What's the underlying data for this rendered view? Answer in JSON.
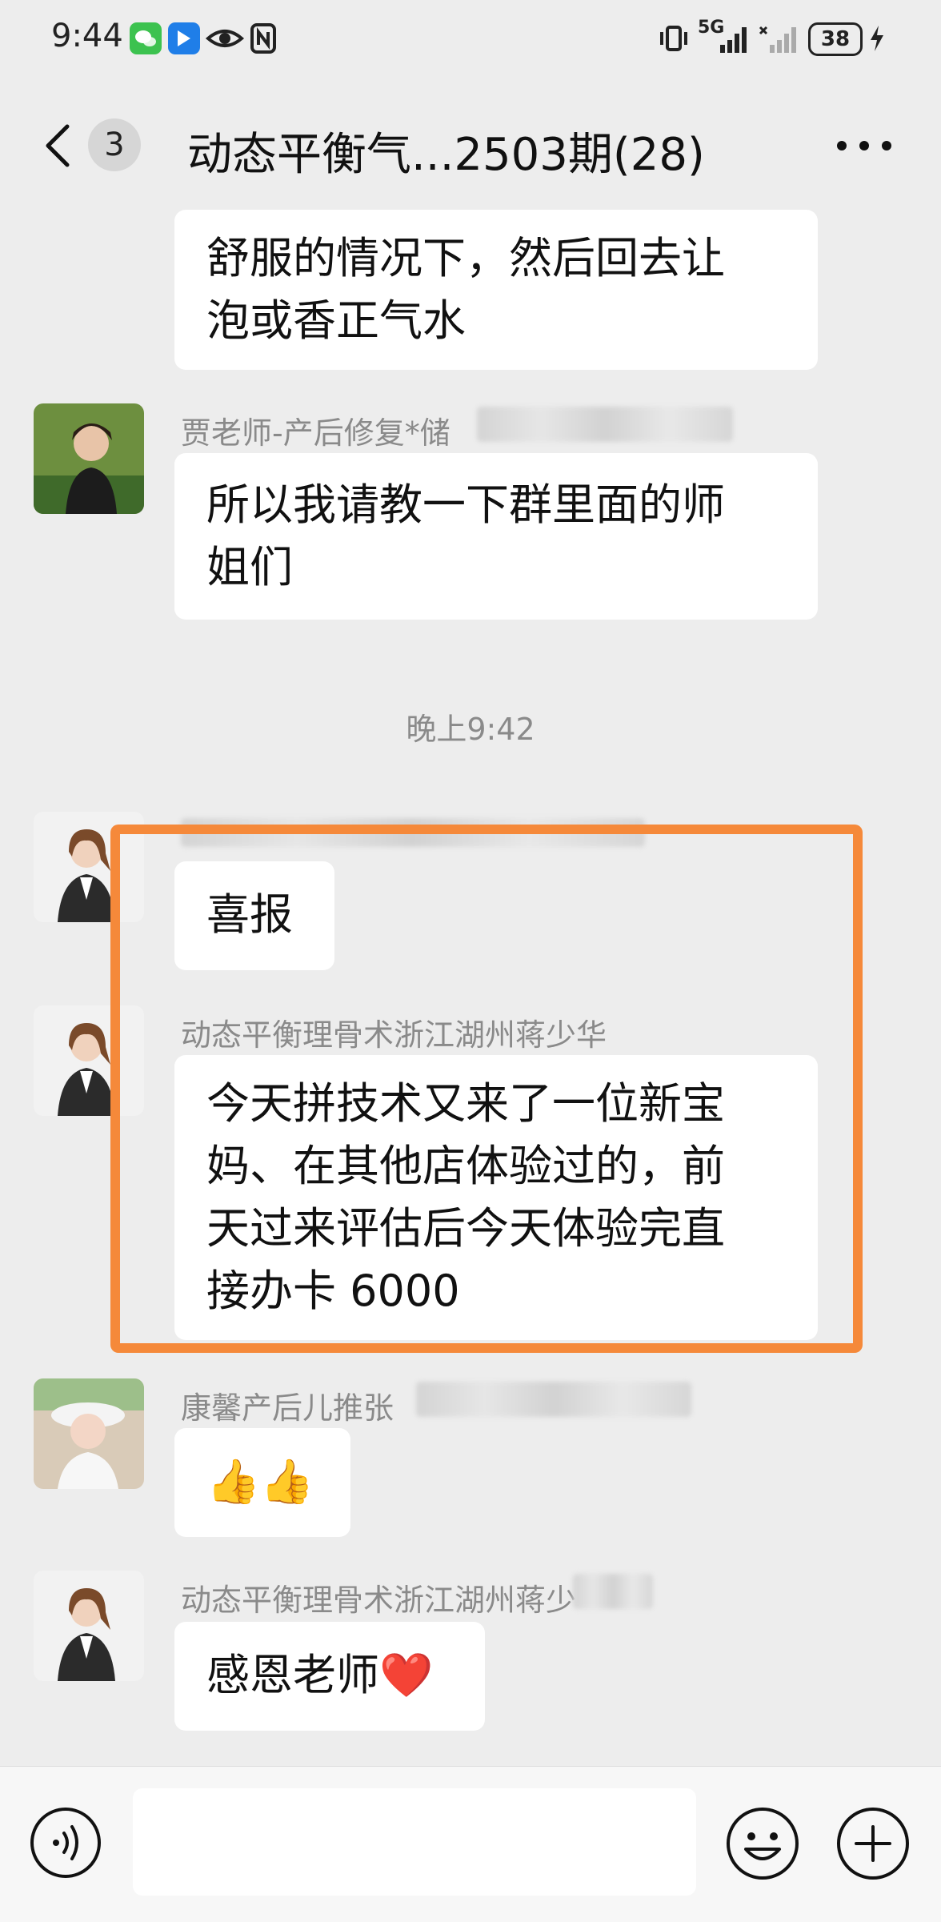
{
  "status_bar": {
    "time": "9:44",
    "network": "5G",
    "battery": "38"
  },
  "nav": {
    "unread_count": "3",
    "title": "动态平衡气...2503期(28)"
  },
  "messages": [
    {
      "id": "m0",
      "text": "舒服的情况下，然后回去让\n泡或香正气水"
    },
    {
      "id": "m1",
      "sender": "贾老师-产后修复*储",
      "text": "所以我请教一下群里面的师\n姐们"
    },
    {
      "id": "m2",
      "sender": "",
      "text": "喜报"
    },
    {
      "id": "m3",
      "sender": "动态平衡理骨术浙江湖州蒋少华",
      "text": "今天拼技术又来了一位新宝\n妈、在其他店体验过的，前\n天过来评估后今天体验完直\n接办卡 6000"
    },
    {
      "id": "m4",
      "sender": "康馨产后儿推张",
      "text": "👍👍"
    },
    {
      "id": "m5",
      "sender": "动态平衡理骨术浙江湖州蒋少",
      "text": "感恩老师❤️"
    }
  ],
  "timestamp": "晚上9:42",
  "colors": {
    "background": "#ededed",
    "bubble": "#ffffff",
    "highlight": "#f5893a",
    "meta_text": "#8a8a8a"
  }
}
